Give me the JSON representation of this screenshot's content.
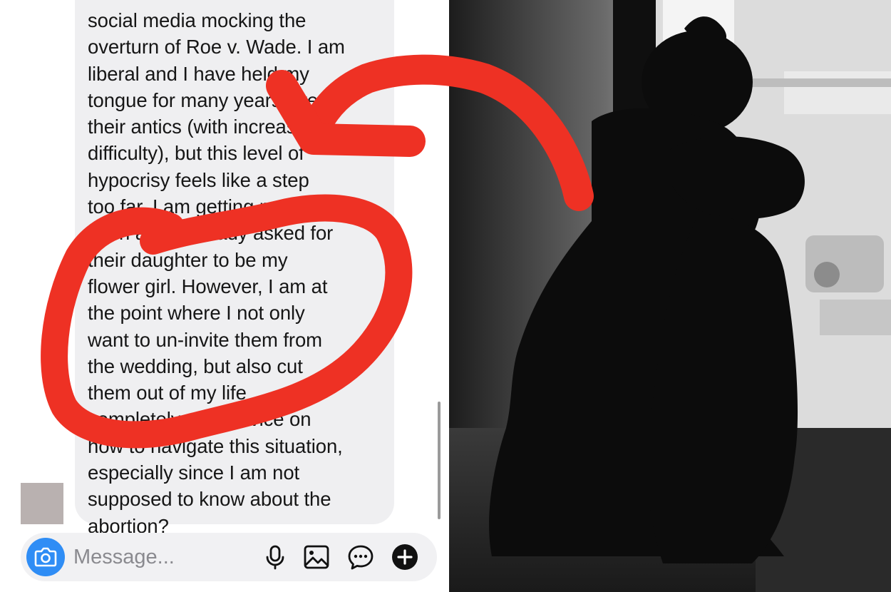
{
  "chat": {
    "message_lines": [
      "social media mocking the",
      "overturn of Roe v. Wade. I am",
      "liberal and I have held my",
      "tongue for many years over",
      "their antics (with increasing",
      "difficulty), but this level of",
      "hypocrisy feels like a step",
      "too far. I am getting married",
      "soon and I already asked for",
      "their daughter to be my",
      "flower girl. However, I am at",
      "the point where I not only",
      "want to un-invite them from",
      "the wedding, but also cut",
      "them out of my life",
      "completely. Any advice on",
      "how to navigate this situation,",
      "especially since I am not",
      "supposed to know about the",
      "abortion?"
    ]
  },
  "composer": {
    "placeholder": "Message...",
    "icons": [
      "camera-icon",
      "microphone-icon",
      "gallery-icon",
      "sticker-icon",
      "plus-icon"
    ]
  },
  "photo": {
    "description_icon": "sad-child-silhouette"
  },
  "colors": {
    "accent_blue": "#2f8df5",
    "bubble_bg": "#efeff1",
    "annotation_red": "#ee3124"
  }
}
